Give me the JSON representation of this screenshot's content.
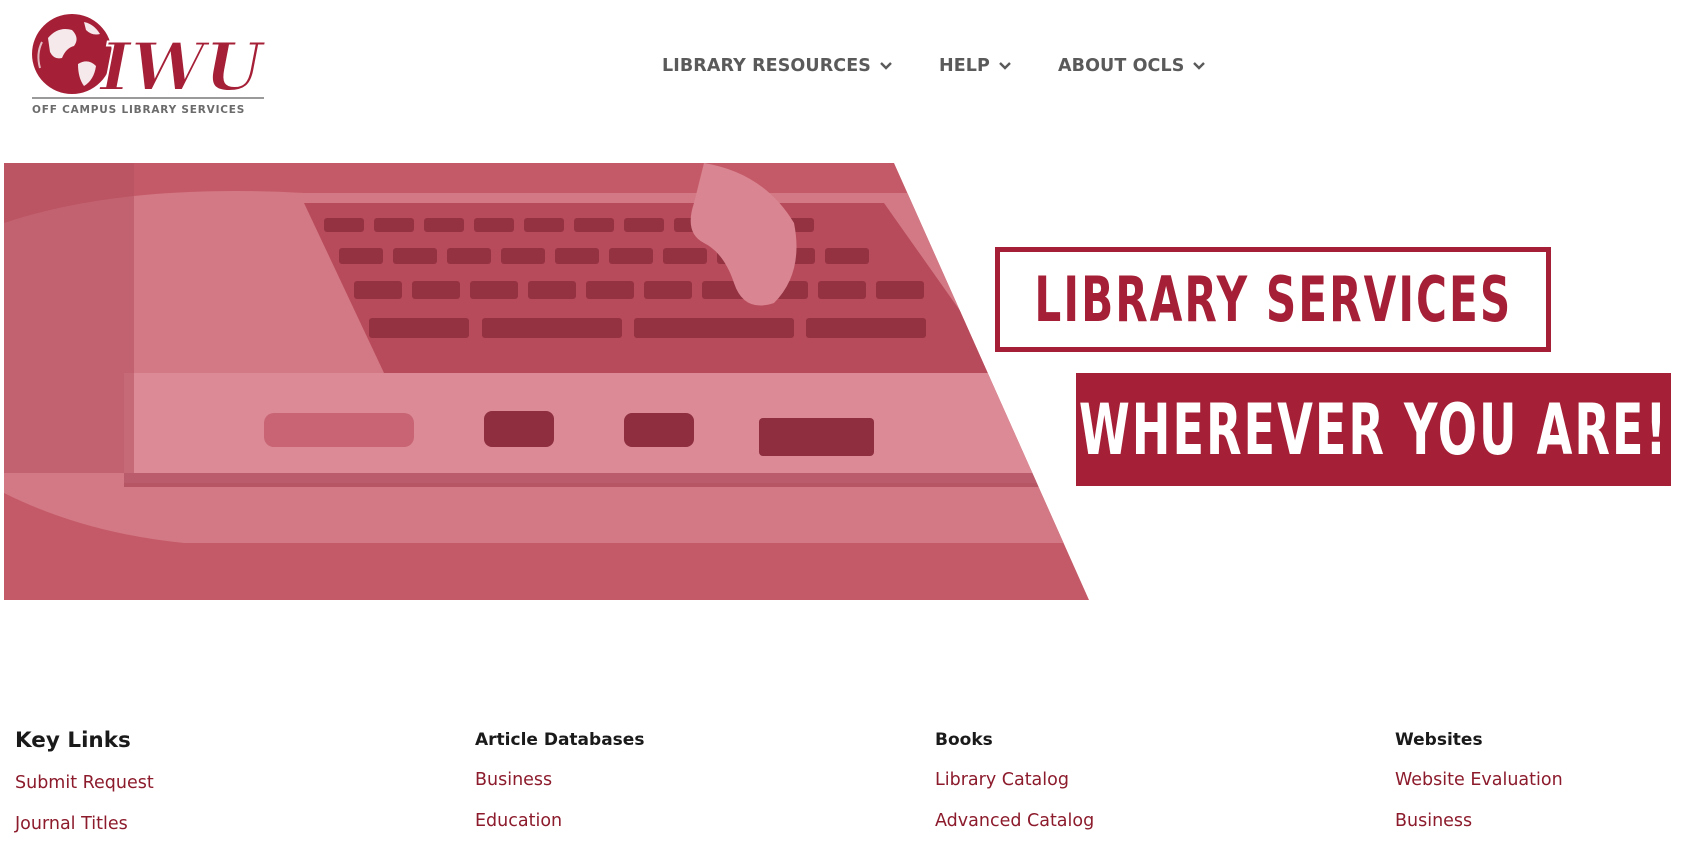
{
  "logo": {
    "wordmark": "IWU",
    "tagline": "OFF CAMPUS LIBRARY SERVICES"
  },
  "nav": {
    "items": [
      {
        "label": "LIBRARY RESOURCES",
        "icon": "chevron-down-icon"
      },
      {
        "label": "HELP",
        "icon": "chevron-down-icon"
      },
      {
        "label": "ABOUT OCLS",
        "icon": "chevron-down-icon"
      }
    ]
  },
  "hero": {
    "line1": "LIBRARY SERVICES",
    "line2": "WHEREVER YOU ARE!"
  },
  "sections": {
    "key_links": {
      "title": "Key Links",
      "links": [
        "Submit Request",
        "Journal Titles"
      ]
    },
    "article_databases": {
      "title": "Article Databases",
      "links": [
        "Business",
        "Education"
      ]
    },
    "books": {
      "title": "Books",
      "links": [
        "Library Catalog",
        "Advanced Catalog"
      ]
    },
    "websites": {
      "title": "Websites",
      "links": [
        "Website Evaluation",
        "Business"
      ]
    }
  },
  "colors": {
    "brand_red": "#a51f36",
    "link_red": "#8c1b2c",
    "nav_gray": "#5a5a5a",
    "photo_tint": "#c45a68"
  }
}
